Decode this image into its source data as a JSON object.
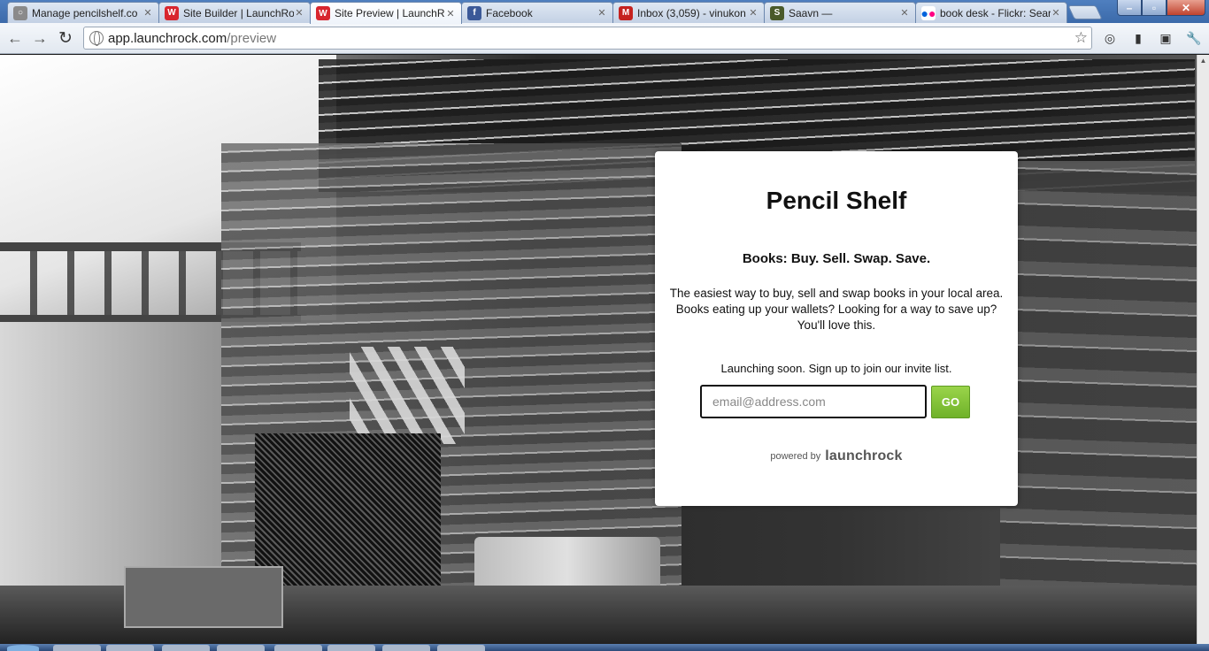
{
  "tabs": [
    {
      "label": "Manage pencilshelf.co",
      "favicon": "globe-icon",
      "color": "#8a8a8a"
    },
    {
      "label": "Site Builder | LaunchRo",
      "favicon": "launchrock-icon",
      "color": "#d8262e"
    },
    {
      "label": "Site Preview | LaunchR",
      "favicon": "launchrock-icon",
      "color": "#d8262e",
      "active": true
    },
    {
      "label": "Facebook",
      "favicon": "facebook-icon",
      "color": "#3b5998"
    },
    {
      "label": "Inbox (3,059) - vinukon",
      "favicon": "gmail-icon",
      "color": "#c5221f"
    },
    {
      "label": "Saavn —",
      "favicon": "saavn-icon",
      "color": "#4a5a2a"
    },
    {
      "label": "book desk - Flickr: Sear",
      "favicon": "flickr-icon",
      "color": "#ff0084"
    }
  ],
  "toolbar": {
    "url_host": "app.launchrock.com",
    "url_path": "/preview"
  },
  "card": {
    "title": "Pencil Shelf",
    "tagline": "Books: Buy. Sell. Swap. Save.",
    "description": "The easiest way to buy, sell and swap books in your local area. Books eating up your wallets? Looking for a way to save up? You'll love this.",
    "launch_text": "Launching soon. Sign up to join our invite list.",
    "email_placeholder": "email@address.com",
    "go_label": "GO",
    "powered_by": "powered by",
    "brand": "launchrock"
  }
}
